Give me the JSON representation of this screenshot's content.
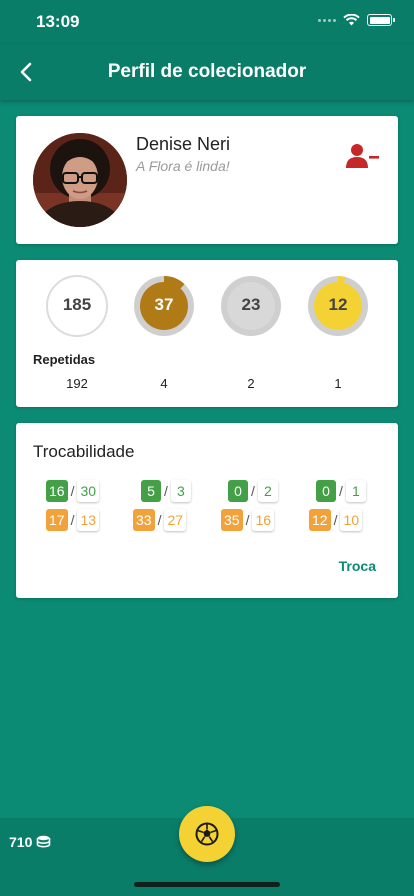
{
  "status_bar": {
    "time": "13:09"
  },
  "header": {
    "title": "Perfil de colecionador"
  },
  "profile": {
    "name": "Denise Neri",
    "motto": "A Flora é linda!"
  },
  "stats": {
    "rings": [
      {
        "value": "185",
        "progress": 0,
        "fill_color": "#ffffff",
        "track_color": "#dcdcdc",
        "text_color": "#444444"
      },
      {
        "value": "37",
        "progress": 0.12,
        "fill_color": "#b07a17",
        "track_color": "#cfcfcf",
        "text_color": "#ffffff"
      },
      {
        "value": "23",
        "progress": 0,
        "fill_color": "#d8d8d8",
        "track_color": "#cfcfcf",
        "text_color": "#444444"
      },
      {
        "value": "12",
        "progress": 0.04,
        "fill_color": "#f5d233",
        "track_color": "#cfcfcf",
        "text_color": "#444444"
      }
    ],
    "repeated_label": "Repetidas",
    "repeated_values": [
      "192",
      "4",
      "2",
      "1"
    ]
  },
  "trade": {
    "title": "Trocabilidade",
    "columns": [
      {
        "green": [
          "16",
          "30"
        ],
        "orange": [
          "17",
          "13"
        ]
      },
      {
        "green": [
          "5",
          "3"
        ],
        "orange": [
          "33",
          "27"
        ]
      },
      {
        "green": [
          "0",
          "2"
        ],
        "orange": [
          "35",
          "16"
        ]
      },
      {
        "green": [
          "0",
          "1"
        ],
        "orange": [
          "12",
          "10"
        ]
      }
    ],
    "action_label": "Troca"
  },
  "bottom": {
    "coins": "710"
  },
  "colors": {
    "primary": "#0b8a74",
    "primary_dark": "#0a7d69",
    "accent": "#f5d233",
    "remove_user": "#c62828"
  },
  "icons": {
    "back": "back-arrow-icon",
    "remove_user": "remove-user-icon",
    "coins": "coin-stack-icon",
    "fab": "soccer-ball-icon"
  }
}
